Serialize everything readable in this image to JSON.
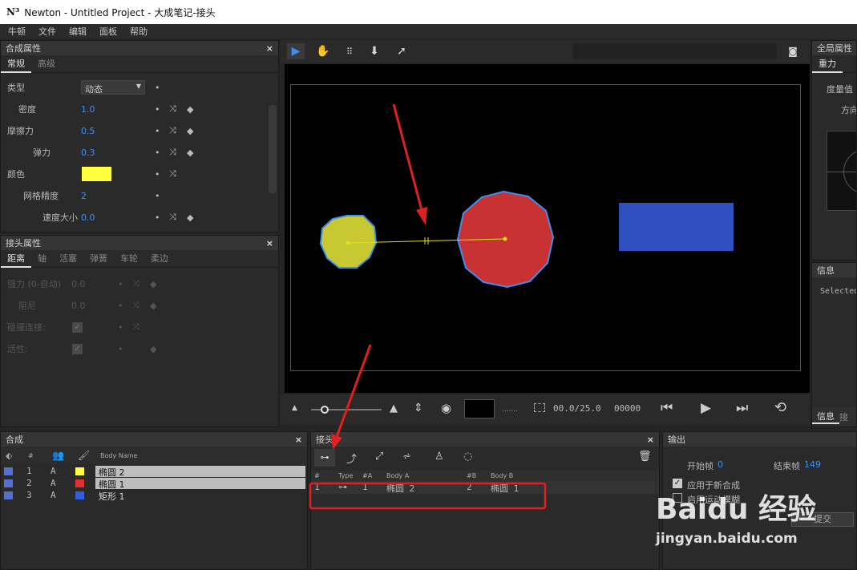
{
  "window": {
    "title": "Newton - Untitled Project - 大成笔记-接头",
    "logo": "N³"
  },
  "menu": [
    "牛顿",
    "文件",
    "编辑",
    "面板",
    "帮助"
  ],
  "composite_props": {
    "title": "合成属性",
    "tabs": [
      "常规",
      "高级"
    ],
    "rows": [
      {
        "label": "类型",
        "value": "动态"
      },
      {
        "label": "密度",
        "value": "1.0"
      },
      {
        "label": "摩擦力",
        "value": "0.5"
      },
      {
        "label": "弹力",
        "value": "0.3"
      },
      {
        "label": "颜色",
        "value": "#ffff40"
      },
      {
        "label": "网格精度",
        "value": "2"
      },
      {
        "label": "速度大小",
        "value": "0.0"
      }
    ]
  },
  "joint_props": {
    "title": "接头属性",
    "tabs": [
      "距离",
      "轴",
      "活塞",
      "弹簧",
      "车轮",
      "柔边"
    ],
    "rows": [
      {
        "label": "强力 (0-自动)",
        "value": "0.0"
      },
      {
        "label": "阻尼",
        "value": "0.0"
      },
      {
        "label": "碰撞连接:"
      },
      {
        "label": "活性:"
      }
    ]
  },
  "viewport": {
    "time": "00.0/25.0",
    "frame": "00000",
    "bodies": [
      {
        "name": "椭圆 2",
        "color": "#c8c832"
      },
      {
        "name": "椭圆 1",
        "color": "#c83232"
      },
      {
        "name": "矩形 1",
        "color": "#3050c0"
      }
    ],
    "joint_color": "#e0e020"
  },
  "global_props": {
    "title": "全局属性",
    "tab": "重力",
    "gravity_label": "度量值",
    "direction_label": "方向"
  },
  "info": {
    "title": "信息",
    "text": "Selected",
    "bottom_tabs": [
      "信息",
      "接"
    ]
  },
  "composition": {
    "title": "合成",
    "columns": [
      "#",
      "Body Name"
    ],
    "rows": [
      {
        "num": "1",
        "mode": "A",
        "color": "#ffff40",
        "name": "椭圆 2"
      },
      {
        "num": "2",
        "mode": "A",
        "color": "#e03030",
        "name": "椭圆 1"
      },
      {
        "num": "3",
        "mode": "A",
        "color": "#3060e0",
        "name": "矩形 1"
      }
    ]
  },
  "joints": {
    "title": "接头",
    "columns": [
      "#",
      "Type",
      "#A",
      "Body A",
      "#B",
      "Body B"
    ],
    "rows": [
      {
        "num": "1",
        "type": "⊶",
        "a": "1",
        "body_a": "椭圆 2",
        "b": "2",
        "body_b": "椭圆 1"
      }
    ]
  },
  "output": {
    "title": "输出",
    "start_label": "开始帧",
    "start": "0",
    "end_label": "结束帧",
    "end": "149",
    "opt1": "应用于新合成",
    "opt2": "启用运动模糊",
    "submit": "提交"
  },
  "watermark": {
    "brand": "Baidu 经验",
    "url": "jingyan.baidu.com"
  },
  "annotation_color": "#e02020"
}
